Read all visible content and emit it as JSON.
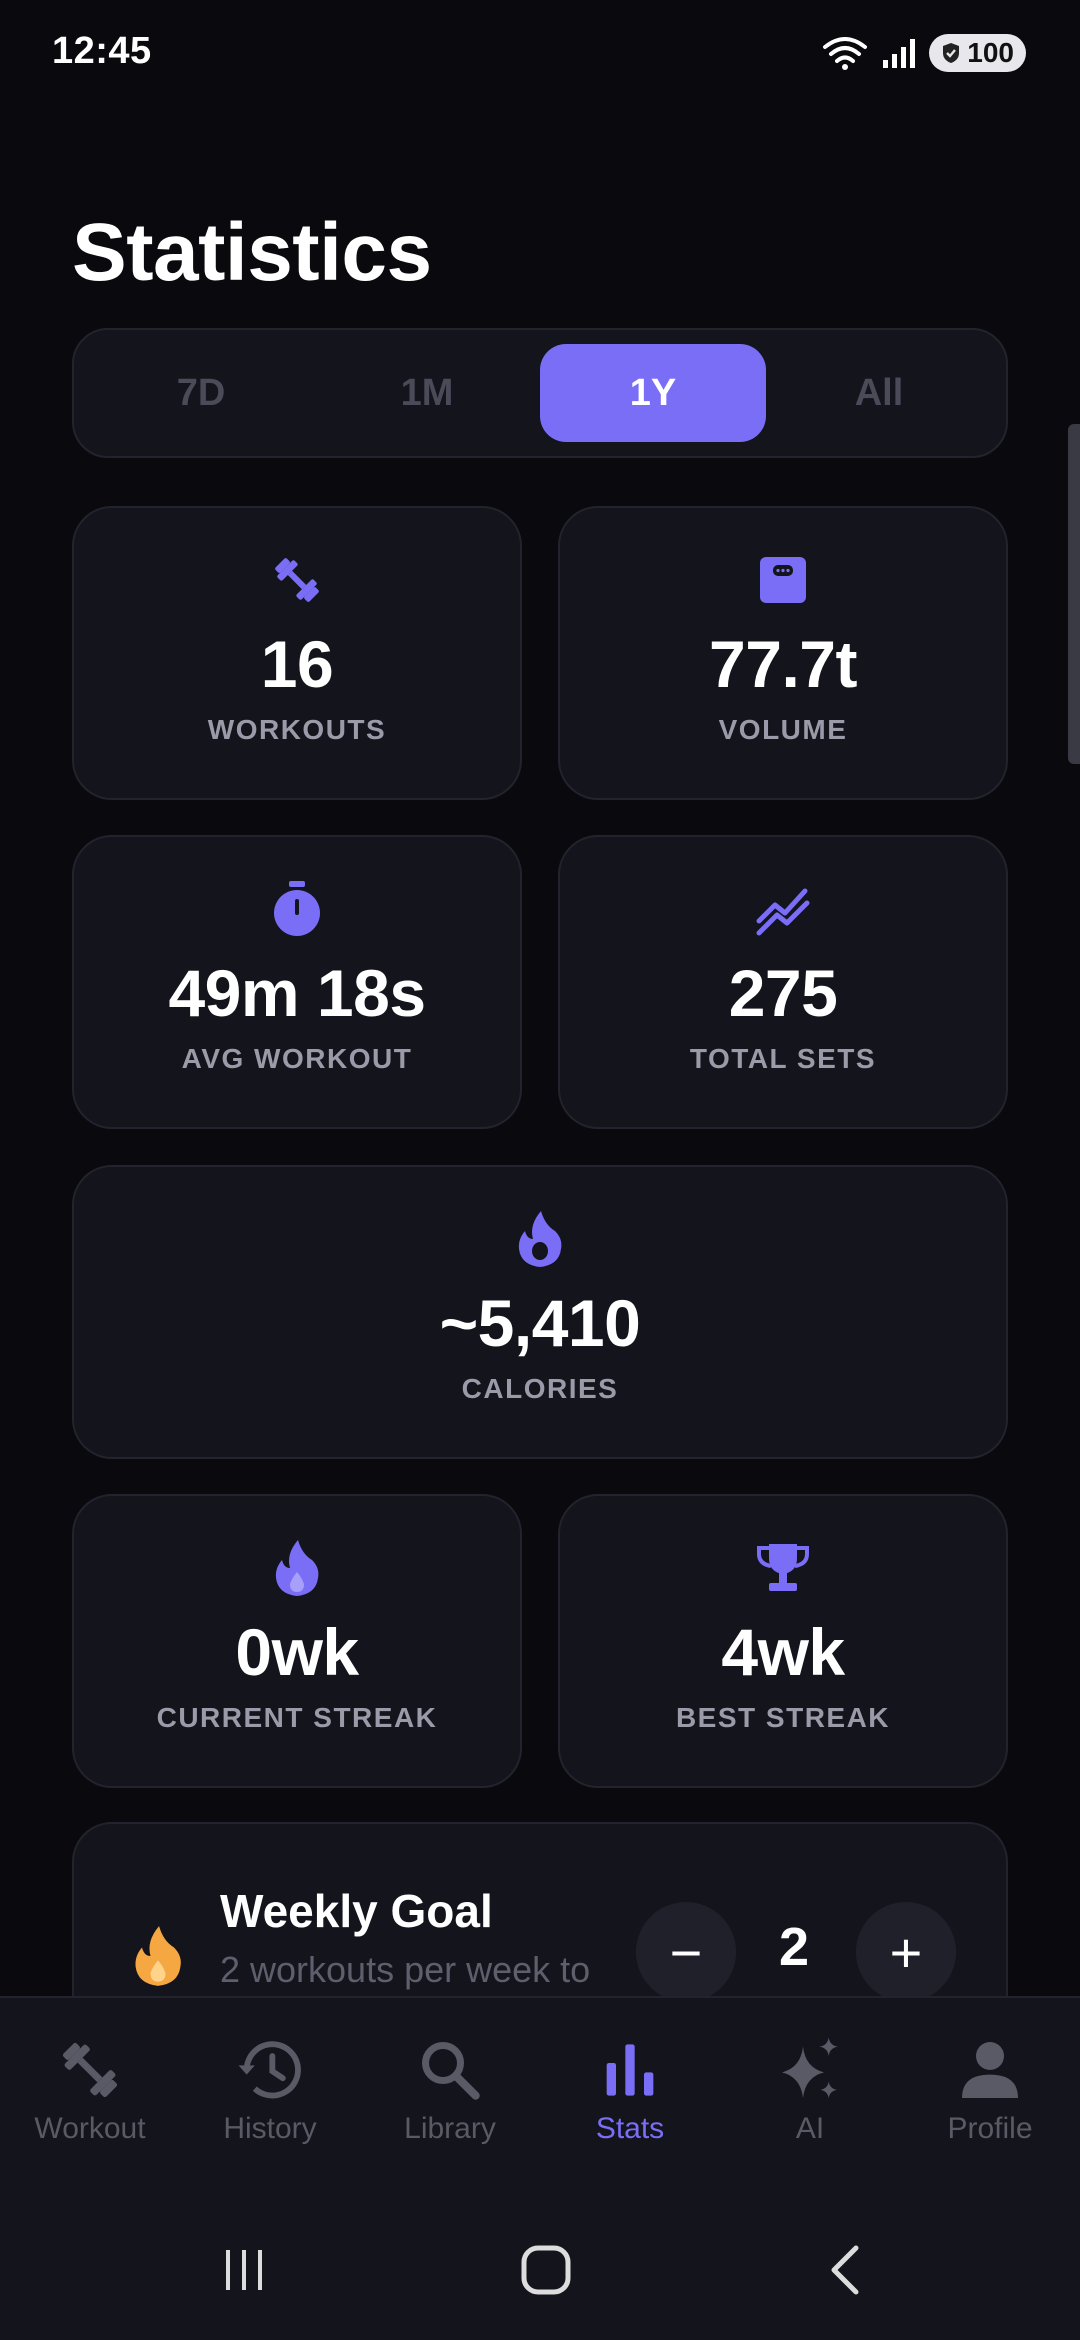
{
  "status_bar": {
    "time": "12:45",
    "battery": "100"
  },
  "page": {
    "title": "Statistics"
  },
  "range_tabs": [
    {
      "label": "7D",
      "active": false
    },
    {
      "label": "1M",
      "active": false
    },
    {
      "label": "1Y",
      "active": true
    },
    {
      "label": "All",
      "active": false
    }
  ],
  "stats": {
    "workouts": {
      "value": "16",
      "label": "WORKOUTS",
      "icon": "dumbbell-icon"
    },
    "volume": {
      "value": "77.7t",
      "label": "VOLUME",
      "icon": "scale-icon"
    },
    "avg_workout": {
      "value": "49m 18s",
      "label": "AVG WORKOUT",
      "icon": "stopwatch-icon"
    },
    "total_sets": {
      "value": "275",
      "label": "TOTAL SETS",
      "icon": "trend-icon"
    },
    "calories": {
      "value": "~5,410",
      "label": "CALORIES",
      "icon": "flame-icon"
    },
    "current_streak": {
      "value": "0wk",
      "label": "CURRENT STREAK",
      "icon": "fire-icon"
    },
    "best_streak": {
      "value": "4wk",
      "label": "BEST STREAK",
      "icon": "trophy-icon"
    }
  },
  "weekly_goal": {
    "title": "Weekly Goal",
    "subtitle": "2 workouts per week to",
    "value": "2",
    "minus": "−",
    "plus": "+"
  },
  "bottom_nav": [
    {
      "label": "Workout",
      "icon": "dumbbell-icon",
      "active": false
    },
    {
      "label": "History",
      "icon": "history-icon",
      "active": false
    },
    {
      "label": "Library",
      "icon": "search-icon",
      "active": false
    },
    {
      "label": "Stats",
      "icon": "bar-chart-icon",
      "active": true
    },
    {
      "label": "AI",
      "icon": "sparkle-icon",
      "active": false
    },
    {
      "label": "Profile",
      "icon": "person-icon",
      "active": false
    }
  ],
  "colors": {
    "accent": "#7b6ef6",
    "card": "#14141c",
    "background": "#0a0a0e",
    "muted": "#9a9aa8",
    "goal_flame": "#f5a742"
  }
}
